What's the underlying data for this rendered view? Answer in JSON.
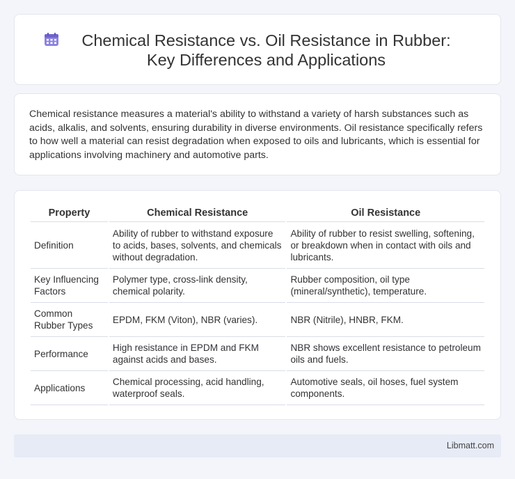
{
  "header": {
    "title": "Chemical Resistance vs. Oil Resistance in Rubber: Key Differences and Applications",
    "icon": "calendar-icon",
    "icon_color": "#7a6fd6"
  },
  "intro": {
    "text": "Chemical resistance measures a material's ability to withstand a variety of harsh substances such as acids, alkalis, and solvents, ensuring durability in diverse environments. Oil resistance specifically refers to how well a material can resist degradation when exposed to oils and lubricants, which is essential for applications involving machinery and automotive parts."
  },
  "table": {
    "headers": [
      "Property",
      "Chemical Resistance",
      "Oil Resistance"
    ],
    "rows": [
      [
        "Definition",
        "Ability of rubber to withstand exposure to acids, bases, solvents, and chemicals without degradation.",
        "Ability of rubber to resist swelling, softening, or breakdown when in contact with oils and lubricants."
      ],
      [
        "Key Influencing Factors",
        "Polymer type, cross-link density, chemical polarity.",
        "Rubber composition, oil type (mineral/synthetic), temperature."
      ],
      [
        "Common Rubber Types",
        "EPDM, FKM (Viton), NBR (varies).",
        "NBR (Nitrile), HNBR, FKM."
      ],
      [
        "Performance",
        "High resistance in EPDM and FKM against acids and bases.",
        "NBR shows excellent resistance to petroleum oils and fuels."
      ],
      [
        "Applications",
        "Chemical processing, acid handling, waterproof seals.",
        "Automotive seals, oil hoses, fuel system components."
      ]
    ]
  },
  "footer": {
    "brand": "Libmatt.com"
  }
}
